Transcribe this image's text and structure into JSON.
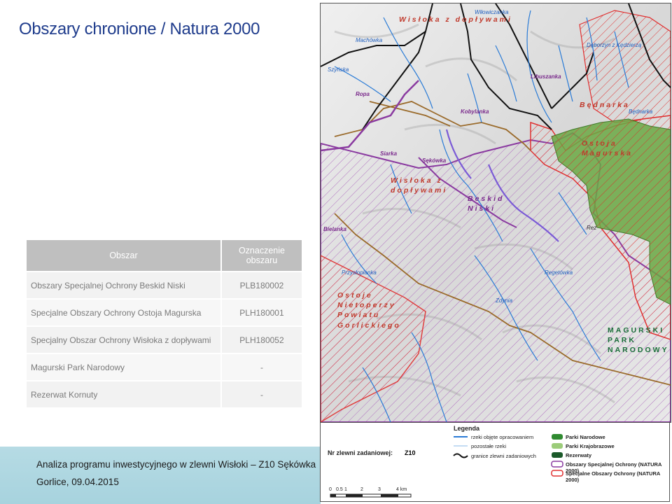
{
  "slide": {
    "title": "Obszary chronione / Natura 2000"
  },
  "table": {
    "headers": [
      "Obszar",
      "Oznaczenie obszaru"
    ],
    "rows": [
      {
        "name": "Obszary Specjalnej Ochrony Beskid Niski",
        "code": "PLB180002"
      },
      {
        "name": "Specjalne Obszary Ochrony Ostoja Magurska",
        "code": "PLH180001"
      },
      {
        "name": "Specjalny Obszar Ochrony Wisłoka z dopływami",
        "code": "PLH180052"
      },
      {
        "name": "Magurski Park Narodowy",
        "code": "-"
      },
      {
        "name": "Rezerwat Kornuty",
        "code": "-"
      }
    ]
  },
  "footer": {
    "line1": "Analiza programu inwestycyjnego w zlewni Wisłoki – Z10 Sękówka",
    "line2": "Gorlice, 09.04.2015"
  },
  "map": {
    "area_labels": [
      {
        "text": "Wisłoka z dopływami",
        "color": "#c0392b"
      },
      {
        "text": "Będnarka",
        "color": "#c0392b"
      },
      {
        "text": "Ostoja Magurska",
        "color": "#c0392b"
      },
      {
        "text": "Wisłoka z dopływami",
        "color": "#c0392b"
      },
      {
        "text": "Beskid Niski",
        "color": "#7a2a8c"
      },
      {
        "text": "Ostoje Nietoperzy Powiatu Gorlickiego",
        "color": "#c0392b"
      },
      {
        "text": "MAGURSKI PARK NARODOWY",
        "color": "#1b6e3a"
      }
    ],
    "rivers": [
      "Wiłowiczanka",
      "Machówka",
      "Szyńska",
      "Ropa",
      "Libuszanka",
      "Kobylanka",
      "Dęborzyn z Kędzierzą",
      "Będnarka",
      "Sękówka",
      "Siarka",
      "Bielanka",
      "Przysłopianka",
      "Zdynia",
      "Regetówka",
      "Rez"
    ],
    "colors": {
      "park": "#6aa843",
      "osoo": "#e03030",
      "soo": "#b070c0",
      "basin": "#9a6a2a",
      "river": "#2a7bd6"
    }
  },
  "legend": {
    "title": "Legenda",
    "zlewnia_label": "Nr zlewni zadaniowej:",
    "zlewnia_value": "Z10",
    "items": [
      "rzeki objęte opracowaniem",
      "pozostałe rzeki",
      "granice zlewni zadaniowych",
      "Parki Narodowe",
      "Parki Krajobrazowe",
      "Rezerwaty",
      "Obszary Specjalnej Ochrony (NATURA 2000)",
      "Specjalne Obszary Ochrony (NATURA 2000)"
    ],
    "scale": [
      "0",
      "0.5",
      "1",
      "2",
      "3",
      "4 km"
    ]
  }
}
